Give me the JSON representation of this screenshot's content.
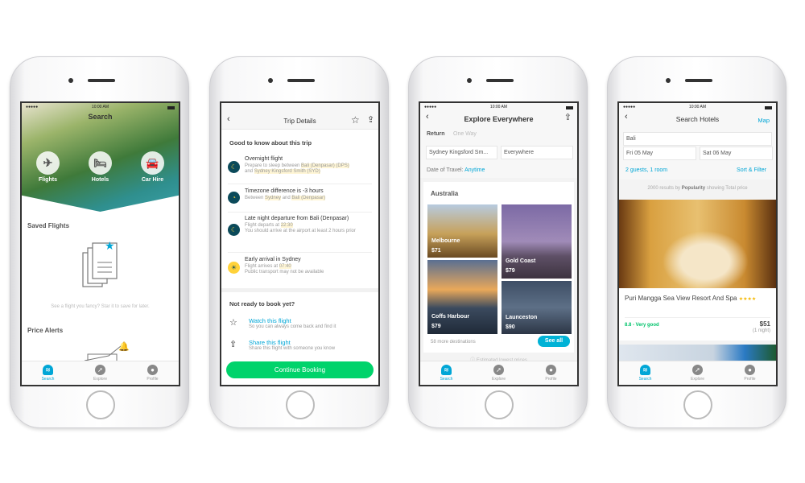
{
  "status": {
    "time": "10:00 AM"
  },
  "tabbar": [
    {
      "label": "Search",
      "icon": "skyscanner-logo-icon"
    },
    {
      "label": "Explore",
      "icon": "compass-icon"
    },
    {
      "label": "Profile",
      "icon": "person-icon"
    }
  ],
  "screen1": {
    "title": "Search",
    "actions": [
      {
        "label": "Flights",
        "icon": "plane-icon"
      },
      {
        "label": "Hotels",
        "icon": "bed-icon"
      },
      {
        "label": "Car Hire",
        "icon": "car-icon"
      }
    ],
    "saved_title": "Saved Flights",
    "saved_hint": "See a flight you fancy? Star it to save for later.",
    "alerts_title": "Price Alerts"
  },
  "screen2": {
    "title": "Trip Details",
    "section1": "Good to know about this trip",
    "items": [
      {
        "title": "Overnight flight",
        "l1a": "Prepare to sleep between ",
        "l1b": "Bali (Denpasar) (DPS)",
        "l2a": "and ",
        "l2b": "Sydney Kingsford Smith (SYD)"
      },
      {
        "title": "Timezone difference is -3 hours",
        "l1a": "Between ",
        "l1b": "Sydney",
        "l1c": " and ",
        "l1d": "Bali (Denpasar)"
      },
      {
        "title": "Late night departure from Bali (Denpasar)",
        "l1a": "Flight departs at ",
        "l1b": "22:30",
        "l2": "You should arrive at the airport at least 2 hours prior"
      },
      {
        "title": "Early arrival in Sydney",
        "l1a": "Flight arrives at ",
        "l1b": "07:40",
        "l2": "Public transport may not be available"
      }
    ],
    "section2": "Not ready to book yet?",
    "watch": {
      "title": "Watch this flight",
      "sub": "So you can always come back and find it"
    },
    "share": {
      "title": "Share this flight",
      "sub": "Share this flight with someone you know"
    },
    "cta": "Continue Booking",
    "cta_color": "#00d36b"
  },
  "screen3": {
    "title": "Explore Everywhere",
    "trip_types": [
      "Return",
      "One Way"
    ],
    "from": "Sydney Kingsford Sm...",
    "to": "Everywhere",
    "date_label": "Date of Travel:",
    "date_value": "Anytime",
    "region": "Australia",
    "destinations": [
      {
        "name": "Melbourne",
        "price": "$71"
      },
      {
        "name": "Gold Coast",
        "price": "$79"
      },
      {
        "name": "Coffs Harbour",
        "price": "$79"
      },
      {
        "name": "Launceston",
        "price": "$90"
      }
    ],
    "more": "58 more destinations",
    "see_all": "See all",
    "note": "Estimated lowest prices"
  },
  "screen4": {
    "title": "Search Hotels",
    "map": "Map",
    "location": "Bali",
    "checkin": "Fri 05 May",
    "checkout": "Sat 06 May",
    "guests": "2 guests, 1 room",
    "sort": "Sort & Filter",
    "results_a": "2000 results by ",
    "results_b": "Popularity",
    "results_c": " showing Total price",
    "hotel": {
      "name": "Puri Mangga Sea View Resort And Spa",
      "stars": "★★★★",
      "rating": "8.8 - Very good",
      "price": "$51",
      "nights": "(1 night)"
    }
  },
  "colors": {
    "accent": "#00a6d6",
    "green": "#00d36b"
  }
}
